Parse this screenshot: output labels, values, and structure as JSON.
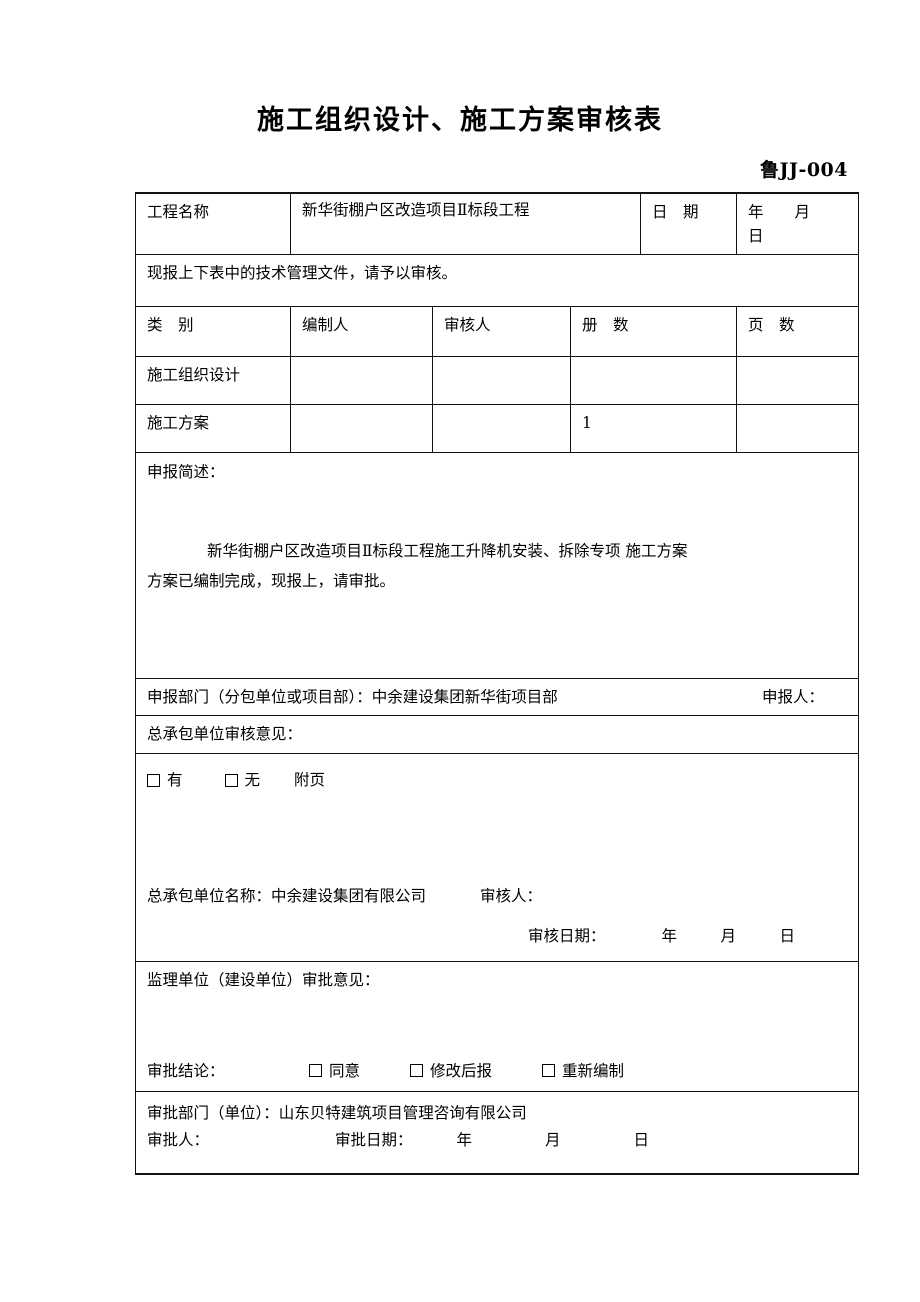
{
  "document": {
    "title": "施工组织设计、施工方案审核表",
    "form_code": "鲁JJ-004"
  },
  "project_row": {
    "label": "工程名称",
    "value": "新华街棚户区改造项目Ⅱ标段工程",
    "date_label": "日　期",
    "date_value": "年　　月　　日"
  },
  "notice": {
    "text": "现报上下表中的技术管理文件，请予以审核。"
  },
  "doc_table": {
    "headers": [
      "类　别",
      "编制人",
      "审核人",
      "册　数",
      "页　数"
    ],
    "rows": [
      {
        "category": "施工组织设计",
        "author": "",
        "reviewer": "",
        "volumes": "",
        "pages": ""
      },
      {
        "category": "施工方案",
        "author": "",
        "reviewer": "",
        "volumes": "1",
        "pages": ""
      }
    ]
  },
  "brief": {
    "label": "申报简述：",
    "line1": "新华街棚户区改造项目Ⅱ标段工程施工升降机安装、拆除专项 施工方案",
    "line2": "方案已编制完成，现报上，请审批。"
  },
  "declare": {
    "department_label": "申报部门（分包单位或项目部）：",
    "department_value": "中余建设集团新华街项目部",
    "declarant_label": "申报人："
  },
  "general_contractor": {
    "section_title": "总承包单位审核意见：",
    "checkbox_yes": "有",
    "checkbox_no": "无",
    "attachment_label": "附页",
    "company_label": "总承包单位名称：",
    "company_value": "中余建设集团有限公司",
    "reviewer_label": "审核人：",
    "review_date_label": "审核日期：",
    "review_date_value": "年　月　日"
  },
  "supervisor": {
    "section_title": "监理单位（建设单位）审批意见：",
    "conclusion_label": "审批结论：",
    "options": [
      "同意",
      "修改后报",
      "重新编制"
    ],
    "department_label": "审批部门（单位）：",
    "department_value": "山东贝特建筑项目管理咨询有限公司",
    "approver_label": "审批人：",
    "approval_date_label": "审批日期：",
    "approval_date_value": "年　　月　　日"
  }
}
